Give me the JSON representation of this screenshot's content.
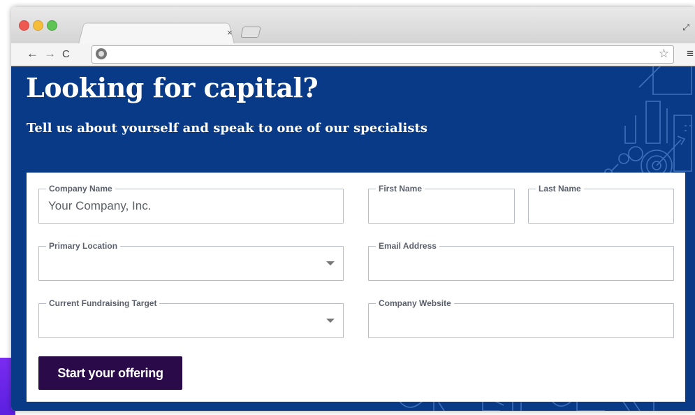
{
  "browser": {
    "tab_close": "×",
    "nav": {
      "back": "←",
      "forward": "→",
      "reload": "C"
    },
    "url": "",
    "icons": [
      "globe-icon",
      "star-icon",
      "menu-icon",
      "fullscreen-icon"
    ]
  },
  "hero": {
    "title": "Looking for capital?",
    "subtitle": "Tell us about yourself and speak to one of our specialists"
  },
  "form": {
    "company_name": {
      "label": "Company Name",
      "value": "Your Company, Inc."
    },
    "first_name": {
      "label": "First Name",
      "value": ""
    },
    "last_name": {
      "label": "Last Name",
      "value": ""
    },
    "primary_location": {
      "label": "Primary Location",
      "value": ""
    },
    "email": {
      "label": "Email Address",
      "value": ""
    },
    "fundraising_target": {
      "label": "Current Fundraising Target",
      "value": ""
    },
    "website": {
      "label": "Company Website",
      "value": ""
    },
    "submit_label": "Start your offering"
  },
  "colors": {
    "hero_bg": "#083a88",
    "button_bg": "#2b0a4a",
    "accent": "#7a2cf0"
  }
}
